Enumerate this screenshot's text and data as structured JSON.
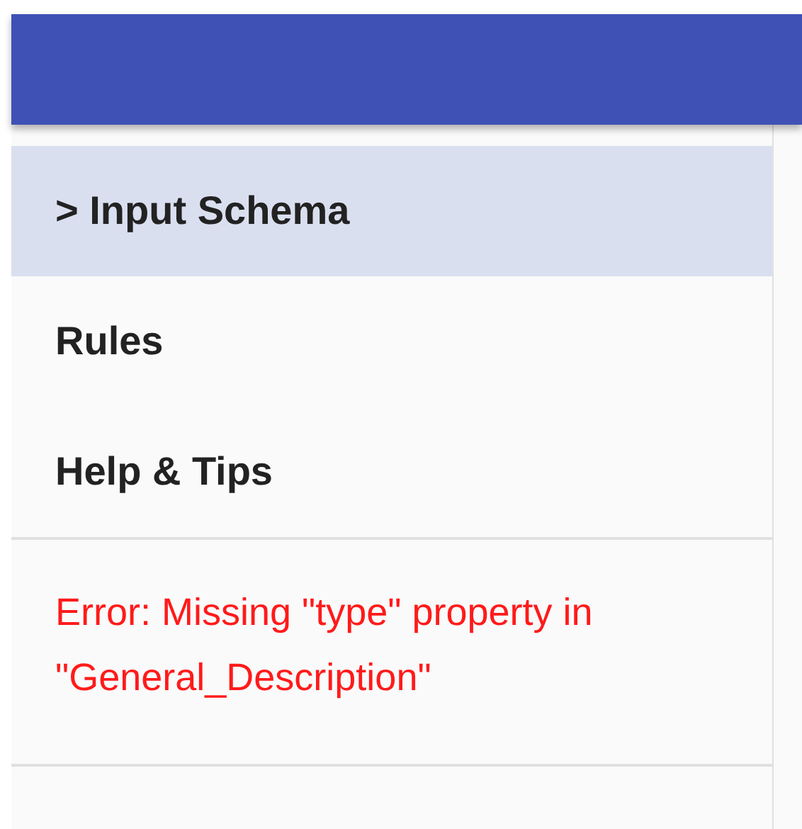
{
  "nav": {
    "items": [
      {
        "label": "> Input Schema",
        "selected": true
      },
      {
        "label": "Rules",
        "selected": false
      },
      {
        "label": "Help & Tips",
        "selected": false
      }
    ]
  },
  "error": {
    "message": "Error: Missing \"type\" property in \"General_Description\""
  }
}
